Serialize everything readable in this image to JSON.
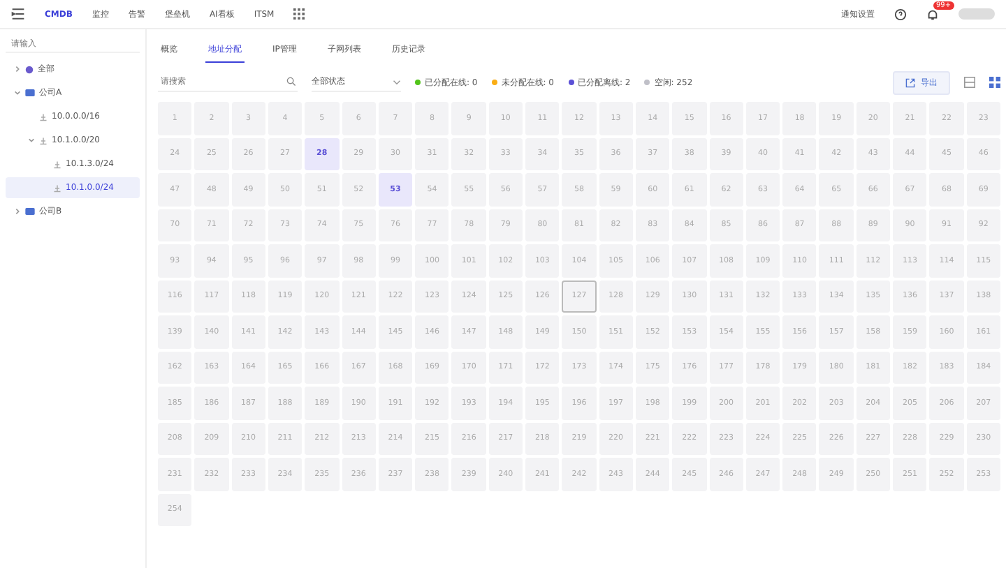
{
  "top_nav": {
    "items": [
      {
        "label": "CMDB",
        "selected": true
      },
      {
        "label": "监控",
        "selected": false
      },
      {
        "label": "告警",
        "selected": false
      },
      {
        "label": "堡垒机",
        "selected": false
      },
      {
        "label": "AI看板",
        "selected": false
      },
      {
        "label": "ITSM",
        "selected": false
      }
    ],
    "settings_link": "通知设置",
    "badge": "99+"
  },
  "sidebar": {
    "search_placeholder": "请输入",
    "tree": [
      {
        "label": "全部",
        "kind": "root",
        "expanded": false,
        "selected": false
      },
      {
        "label": "公司A",
        "kind": "company",
        "expanded": true,
        "selected": false,
        "children": [
          {
            "label": "10.0.0.0/16",
            "kind": "subnet",
            "expanded": false,
            "selected": false
          },
          {
            "label": "10.1.0.0/20",
            "kind": "subnet",
            "expanded": true,
            "selected": false,
            "children": [
              {
                "label": "10.1.3.0/24",
                "kind": "subnet",
                "expanded": false,
                "selected": false
              },
              {
                "label": "10.1.0.0/24",
                "kind": "subnet",
                "expanded": false,
                "selected": true
              }
            ]
          }
        ]
      },
      {
        "label": "公司B",
        "kind": "company",
        "expanded": false,
        "selected": false
      }
    ]
  },
  "tabs": [
    {
      "label": "概览",
      "selected": false
    },
    {
      "label": "地址分配",
      "selected": true
    },
    {
      "label": "IP管理",
      "selected": false
    },
    {
      "label": "子网列表",
      "selected": false
    },
    {
      "label": "历史记录",
      "selected": false
    }
  ],
  "filter": {
    "search_placeholder": "请搜索",
    "status_select": "全部状态",
    "legend": [
      {
        "label": "已分配在线: 0",
        "color": "#52c41a"
      },
      {
        "label": "未分配在线: 0",
        "color": "#faad14"
      },
      {
        "label": "已分配离线: 2",
        "color": "#5b50d6"
      },
      {
        "label": "空闲: 252",
        "color": "#c0c0c8"
      }
    ],
    "export_button": "导出"
  },
  "cells": [
    {
      "label": "1",
      "kind": "free",
      "selected": false
    },
    {
      "label": "2",
      "kind": "free",
      "selected": false
    },
    {
      "label": "3",
      "kind": "free",
      "selected": false
    },
    {
      "label": "4",
      "kind": "free",
      "selected": false
    },
    {
      "label": "5",
      "kind": "free",
      "selected": false
    },
    {
      "label": "6",
      "kind": "free",
      "selected": false
    },
    {
      "label": "7",
      "kind": "free",
      "selected": false
    },
    {
      "label": "8",
      "kind": "free",
      "selected": false
    },
    {
      "label": "9",
      "kind": "free",
      "selected": false
    },
    {
      "label": "10",
      "kind": "free",
      "selected": false
    },
    {
      "label": "11",
      "kind": "free",
      "selected": false
    },
    {
      "label": "12",
      "kind": "free",
      "selected": false
    },
    {
      "label": "13",
      "kind": "free",
      "selected": false
    },
    {
      "label": "14",
      "kind": "free",
      "selected": false
    },
    {
      "label": "15",
      "kind": "free",
      "selected": false
    },
    {
      "label": "16",
      "kind": "free",
      "selected": false
    },
    {
      "label": "17",
      "kind": "free",
      "selected": false
    },
    {
      "label": "18",
      "kind": "free",
      "selected": false
    },
    {
      "label": "19",
      "kind": "free",
      "selected": false
    },
    {
      "label": "20",
      "kind": "free",
      "selected": false
    },
    {
      "label": "21",
      "kind": "free",
      "selected": false
    },
    {
      "label": "22",
      "kind": "free",
      "selected": false
    },
    {
      "label": "23",
      "kind": "free",
      "selected": false
    },
    {
      "label": "24",
      "kind": "free",
      "selected": false
    },
    {
      "label": "25",
      "kind": "free",
      "selected": false
    },
    {
      "label": "26",
      "kind": "free",
      "selected": false
    },
    {
      "label": "27",
      "kind": "free",
      "selected": false
    },
    {
      "label": "28",
      "kind": "offline",
      "selected": false
    },
    {
      "label": "29",
      "kind": "free",
      "selected": false
    },
    {
      "label": "30",
      "kind": "free",
      "selected": false
    },
    {
      "label": "31",
      "kind": "free",
      "selected": false
    },
    {
      "label": "32",
      "kind": "free",
      "selected": false
    },
    {
      "label": "33",
      "kind": "free",
      "selected": false
    },
    {
      "label": "34",
      "kind": "free",
      "selected": false
    },
    {
      "label": "35",
      "kind": "free",
      "selected": false
    },
    {
      "label": "36",
      "kind": "free",
      "selected": false
    },
    {
      "label": "37",
      "kind": "free",
      "selected": false
    },
    {
      "label": "38",
      "kind": "free",
      "selected": false
    },
    {
      "label": "39",
      "kind": "free",
      "selected": false
    },
    {
      "label": "40",
      "kind": "free",
      "selected": false
    },
    {
      "label": "41",
      "kind": "free",
      "selected": false
    },
    {
      "label": "42",
      "kind": "free",
      "selected": false
    },
    {
      "label": "43",
      "kind": "free",
      "selected": false
    },
    {
      "label": "44",
      "kind": "free",
      "selected": false
    },
    {
      "label": "45",
      "kind": "free",
      "selected": false
    },
    {
      "label": "46",
      "kind": "free",
      "selected": false
    },
    {
      "label": "47",
      "kind": "free",
      "selected": false
    },
    {
      "label": "48",
      "kind": "free",
      "selected": false
    },
    {
      "label": "49",
      "kind": "free",
      "selected": false
    },
    {
      "label": "50",
      "kind": "free",
      "selected": false
    },
    {
      "label": "51",
      "kind": "free",
      "selected": false
    },
    {
      "label": "52",
      "kind": "free",
      "selected": false
    },
    {
      "label": "53",
      "kind": "offline",
      "selected": false
    },
    {
      "label": "54",
      "kind": "free",
      "selected": false
    },
    {
      "label": "55",
      "kind": "free",
      "selected": false
    },
    {
      "label": "56",
      "kind": "free",
      "selected": false
    },
    {
      "label": "57",
      "kind": "free",
      "selected": false
    },
    {
      "label": "58",
      "kind": "free",
      "selected": false
    },
    {
      "label": "59",
      "kind": "free",
      "selected": false
    },
    {
      "label": "60",
      "kind": "free",
      "selected": false
    },
    {
      "label": "61",
      "kind": "free",
      "selected": false
    },
    {
      "label": "62",
      "kind": "free",
      "selected": false
    },
    {
      "label": "63",
      "kind": "free",
      "selected": false
    },
    {
      "label": "64",
      "kind": "free",
      "selected": false
    },
    {
      "label": "65",
      "kind": "free",
      "selected": false
    },
    {
      "label": "66",
      "kind": "free",
      "selected": false
    },
    {
      "label": "67",
      "kind": "free",
      "selected": false
    },
    {
      "label": "68",
      "kind": "free",
      "selected": false
    },
    {
      "label": "69",
      "kind": "free",
      "selected": false
    },
    {
      "label": "70",
      "kind": "free",
      "selected": false
    },
    {
      "label": "71",
      "kind": "free",
      "selected": false
    },
    {
      "label": "72",
      "kind": "free",
      "selected": false
    },
    {
      "label": "73",
      "kind": "free",
      "selected": false
    },
    {
      "label": "74",
      "kind": "free",
      "selected": false
    },
    {
      "label": "75",
      "kind": "free",
      "selected": false
    },
    {
      "label": "76",
      "kind": "free",
      "selected": false
    },
    {
      "label": "77",
      "kind": "free",
      "selected": false
    },
    {
      "label": "78",
      "kind": "free",
      "selected": false
    },
    {
      "label": "79",
      "kind": "free",
      "selected": false
    },
    {
      "label": "80",
      "kind": "free",
      "selected": false
    },
    {
      "label": "81",
      "kind": "free",
      "selected": false
    },
    {
      "label": "82",
      "kind": "free",
      "selected": false
    },
    {
      "label": "83",
      "kind": "free",
      "selected": false
    },
    {
      "label": "84",
      "kind": "free",
      "selected": false
    },
    {
      "label": "85",
      "kind": "free",
      "selected": false
    },
    {
      "label": "86",
      "kind": "free",
      "selected": false
    },
    {
      "label": "87",
      "kind": "free",
      "selected": false
    },
    {
      "label": "88",
      "kind": "free",
      "selected": false
    },
    {
      "label": "89",
      "kind": "free",
      "selected": false
    },
    {
      "label": "90",
      "kind": "free",
      "selected": false
    },
    {
      "label": "91",
      "kind": "free",
      "selected": false
    },
    {
      "label": "92",
      "kind": "free",
      "selected": false
    },
    {
      "label": "93",
      "kind": "free",
      "selected": false
    },
    {
      "label": "94",
      "kind": "free",
      "selected": false
    },
    {
      "label": "95",
      "kind": "free",
      "selected": false
    },
    {
      "label": "96",
      "kind": "free",
      "selected": false
    },
    {
      "label": "97",
      "kind": "free",
      "selected": false
    },
    {
      "label": "98",
      "kind": "free",
      "selected": false
    },
    {
      "label": "99",
      "kind": "free",
      "selected": false
    },
    {
      "label": "100",
      "kind": "free",
      "selected": false
    },
    {
      "label": "101",
      "kind": "free",
      "selected": false
    },
    {
      "label": "102",
      "kind": "free",
      "selected": false
    },
    {
      "label": "103",
      "kind": "free",
      "selected": false
    },
    {
      "label": "104",
      "kind": "free",
      "selected": false
    },
    {
      "label": "105",
      "kind": "free",
      "selected": false
    },
    {
      "label": "106",
      "kind": "free",
      "selected": false
    },
    {
      "label": "107",
      "kind": "free",
      "selected": false
    },
    {
      "label": "108",
      "kind": "free",
      "selected": false
    },
    {
      "label": "109",
      "kind": "free",
      "selected": false
    },
    {
      "label": "110",
      "kind": "free",
      "selected": false
    },
    {
      "label": "111",
      "kind": "free",
      "selected": false
    },
    {
      "label": "112",
      "kind": "free",
      "selected": false
    },
    {
      "label": "113",
      "kind": "free",
      "selected": false
    },
    {
      "label": "114",
      "kind": "free",
      "selected": false
    },
    {
      "label": "115",
      "kind": "free",
      "selected": false
    },
    {
      "label": "116",
      "kind": "free",
      "selected": false
    },
    {
      "label": "117",
      "kind": "free",
      "selected": false
    },
    {
      "label": "118",
      "kind": "free",
      "selected": false
    },
    {
      "label": "119",
      "kind": "free",
      "selected": false
    },
    {
      "label": "120",
      "kind": "free",
      "selected": false
    },
    {
      "label": "121",
      "kind": "free",
      "selected": false
    },
    {
      "label": "122",
      "kind": "free",
      "selected": false
    },
    {
      "label": "123",
      "kind": "free",
      "selected": false
    },
    {
      "label": "124",
      "kind": "free",
      "selected": false
    },
    {
      "label": "125",
      "kind": "free",
      "selected": false
    },
    {
      "label": "126",
      "kind": "free",
      "selected": false
    },
    {
      "label": "127",
      "kind": "free",
      "selected": true
    },
    {
      "label": "128",
      "kind": "free",
      "selected": false
    },
    {
      "label": "129",
      "kind": "free",
      "selected": false
    },
    {
      "label": "130",
      "kind": "free",
      "selected": false
    },
    {
      "label": "131",
      "kind": "free",
      "selected": false
    },
    {
      "label": "132",
      "kind": "free",
      "selected": false
    },
    {
      "label": "133",
      "kind": "free",
      "selected": false
    },
    {
      "label": "134",
      "kind": "free",
      "selected": false
    },
    {
      "label": "135",
      "kind": "free",
      "selected": false
    },
    {
      "label": "136",
      "kind": "free",
      "selected": false
    },
    {
      "label": "137",
      "kind": "free",
      "selected": false
    },
    {
      "label": "138",
      "kind": "free",
      "selected": false
    },
    {
      "label": "139",
      "kind": "free",
      "selected": false
    },
    {
      "label": "140",
      "kind": "free",
      "selected": false
    },
    {
      "label": "141",
      "kind": "free",
      "selected": false
    },
    {
      "label": "142",
      "kind": "free",
      "selected": false
    },
    {
      "label": "143",
      "kind": "free",
      "selected": false
    },
    {
      "label": "144",
      "kind": "free",
      "selected": false
    },
    {
      "label": "145",
      "kind": "free",
      "selected": false
    },
    {
      "label": "146",
      "kind": "free",
      "selected": false
    },
    {
      "label": "147",
      "kind": "free",
      "selected": false
    },
    {
      "label": "148",
      "kind": "free",
      "selected": false
    },
    {
      "label": "149",
      "kind": "free",
      "selected": false
    },
    {
      "label": "150",
      "kind": "free",
      "selected": false
    },
    {
      "label": "151",
      "kind": "free",
      "selected": false
    },
    {
      "label": "152",
      "kind": "free",
      "selected": false
    },
    {
      "label": "153",
      "kind": "free",
      "selected": false
    },
    {
      "label": "154",
      "kind": "free",
      "selected": false
    },
    {
      "label": "155",
      "kind": "free",
      "selected": false
    },
    {
      "label": "156",
      "kind": "free",
      "selected": false
    },
    {
      "label": "157",
      "kind": "free",
      "selected": false
    },
    {
      "label": "158",
      "kind": "free",
      "selected": false
    },
    {
      "label": "159",
      "kind": "free",
      "selected": false
    },
    {
      "label": "160",
      "kind": "free",
      "selected": false
    },
    {
      "label": "161",
      "kind": "free",
      "selected": false
    },
    {
      "label": "162",
      "kind": "free",
      "selected": false
    },
    {
      "label": "163",
      "kind": "free",
      "selected": false
    },
    {
      "label": "164",
      "kind": "free",
      "selected": false
    },
    {
      "label": "165",
      "kind": "free",
      "selected": false
    },
    {
      "label": "166",
      "kind": "free",
      "selected": false
    },
    {
      "label": "167",
      "kind": "free",
      "selected": false
    },
    {
      "label": "168",
      "kind": "free",
      "selected": false
    },
    {
      "label": "169",
      "kind": "free",
      "selected": false
    },
    {
      "label": "170",
      "kind": "free",
      "selected": false
    },
    {
      "label": "171",
      "kind": "free",
      "selected": false
    },
    {
      "label": "172",
      "kind": "free",
      "selected": false
    },
    {
      "label": "173",
      "kind": "free",
      "selected": false
    },
    {
      "label": "174",
      "kind": "free",
      "selected": false
    },
    {
      "label": "175",
      "kind": "free",
      "selected": false
    },
    {
      "label": "176",
      "kind": "free",
      "selected": false
    },
    {
      "label": "177",
      "kind": "free",
      "selected": false
    },
    {
      "label": "178",
      "kind": "free",
      "selected": false
    },
    {
      "label": "179",
      "kind": "free",
      "selected": false
    },
    {
      "label": "180",
      "kind": "free",
      "selected": false
    },
    {
      "label": "181",
      "kind": "free",
      "selected": false
    },
    {
      "label": "182",
      "kind": "free",
      "selected": false
    },
    {
      "label": "183",
      "kind": "free",
      "selected": false
    },
    {
      "label": "184",
      "kind": "free",
      "selected": false
    },
    {
      "label": "185",
      "kind": "free",
      "selected": false
    },
    {
      "label": "186",
      "kind": "free",
      "selected": false
    },
    {
      "label": "187",
      "kind": "free",
      "selected": false
    },
    {
      "label": "188",
      "kind": "free",
      "selected": false
    },
    {
      "label": "189",
      "kind": "free",
      "selected": false
    },
    {
      "label": "190",
      "kind": "free",
      "selected": false
    },
    {
      "label": "191",
      "kind": "free",
      "selected": false
    },
    {
      "label": "192",
      "kind": "free",
      "selected": false
    },
    {
      "label": "193",
      "kind": "free",
      "selected": false
    },
    {
      "label": "194",
      "kind": "free",
      "selected": false
    },
    {
      "label": "195",
      "kind": "free",
      "selected": false
    },
    {
      "label": "196",
      "kind": "free",
      "selected": false
    },
    {
      "label": "197",
      "kind": "free",
      "selected": false
    },
    {
      "label": "198",
      "kind": "free",
      "selected": false
    },
    {
      "label": "199",
      "kind": "free",
      "selected": false
    },
    {
      "label": "200",
      "kind": "free",
      "selected": false
    },
    {
      "label": "201",
      "kind": "free",
      "selected": false
    },
    {
      "label": "202",
      "kind": "free",
      "selected": false
    },
    {
      "label": "203",
      "kind": "free",
      "selected": false
    },
    {
      "label": "204",
      "kind": "free",
      "selected": false
    },
    {
      "label": "205",
      "kind": "free",
      "selected": false
    },
    {
      "label": "206",
      "kind": "free",
      "selected": false
    },
    {
      "label": "207",
      "kind": "free",
      "selected": false
    },
    {
      "label": "208",
      "kind": "free",
      "selected": false
    },
    {
      "label": "209",
      "kind": "free",
      "selected": false
    },
    {
      "label": "210",
      "kind": "free",
      "selected": false
    },
    {
      "label": "211",
      "kind": "free",
      "selected": false
    },
    {
      "label": "212",
      "kind": "free",
      "selected": false
    },
    {
      "label": "213",
      "kind": "free",
      "selected": false
    },
    {
      "label": "214",
      "kind": "free",
      "selected": false
    },
    {
      "label": "215",
      "kind": "free",
      "selected": false
    },
    {
      "label": "216",
      "kind": "free",
      "selected": false
    },
    {
      "label": "217",
      "kind": "free",
      "selected": false
    },
    {
      "label": "218",
      "kind": "free",
      "selected": false
    },
    {
      "label": "219",
      "kind": "free",
      "selected": false
    },
    {
      "label": "220",
      "kind": "free",
      "selected": false
    },
    {
      "label": "221",
      "kind": "free",
      "selected": false
    },
    {
      "label": "222",
      "kind": "free",
      "selected": false
    },
    {
      "label": "223",
      "kind": "free",
      "selected": false
    },
    {
      "label": "224",
      "kind": "free",
      "selected": false
    },
    {
      "label": "225",
      "kind": "free",
      "selected": false
    },
    {
      "label": "226",
      "kind": "free",
      "selected": false
    },
    {
      "label": "227",
      "kind": "free",
      "selected": false
    },
    {
      "label": "228",
      "kind": "free",
      "selected": false
    },
    {
      "label": "229",
      "kind": "free",
      "selected": false
    },
    {
      "label": "230",
      "kind": "free",
      "selected": false
    },
    {
      "label": "231",
      "kind": "free",
      "selected": false
    },
    {
      "label": "232",
      "kind": "free",
      "selected": false
    },
    {
      "label": "233",
      "kind": "free",
      "selected": false
    },
    {
      "label": "234",
      "kind": "free",
      "selected": false
    },
    {
      "label": "235",
      "kind": "free",
      "selected": false
    },
    {
      "label": "236",
      "kind": "free",
      "selected": false
    },
    {
      "label": "237",
      "kind": "free",
      "selected": false
    },
    {
      "label": "238",
      "kind": "free",
      "selected": false
    },
    {
      "label": "239",
      "kind": "free",
      "selected": false
    },
    {
      "label": "240",
      "kind": "free",
      "selected": false
    },
    {
      "label": "241",
      "kind": "free",
      "selected": false
    },
    {
      "label": "242",
      "kind": "free",
      "selected": false
    },
    {
      "label": "243",
      "kind": "free",
      "selected": false
    },
    {
      "label": "244",
      "kind": "free",
      "selected": false
    },
    {
      "label": "245",
      "kind": "free",
      "selected": false
    },
    {
      "label": "246",
      "kind": "free",
      "selected": false
    },
    {
      "label": "247",
      "kind": "free",
      "selected": false
    },
    {
      "label": "248",
      "kind": "free",
      "selected": false
    },
    {
      "label": "249",
      "kind": "free",
      "selected": false
    },
    {
      "label": "250",
      "kind": "free",
      "selected": false
    },
    {
      "label": "251",
      "kind": "free",
      "selected": false
    },
    {
      "label": "252",
      "kind": "free",
      "selected": false
    },
    {
      "label": "253",
      "kind": "free",
      "selected": false
    },
    {
      "label": "254",
      "kind": "free",
      "selected": false
    }
  ]
}
